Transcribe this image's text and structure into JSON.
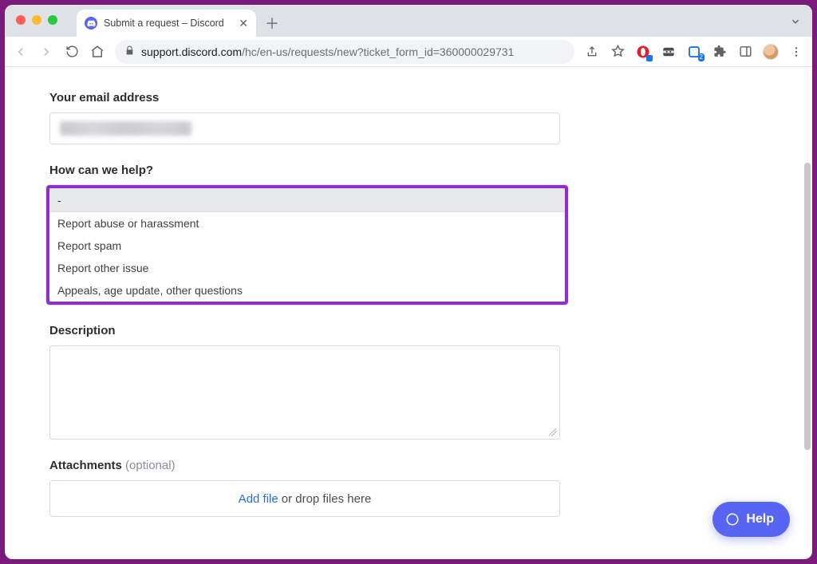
{
  "browser": {
    "tab_title": "Submit a request – Discord",
    "url_host": "support.discord.com",
    "url_path": "/hc/en-us/requests/new?ticket_form_id=360000029731",
    "extension_badge": "2"
  },
  "form": {
    "email_label": "Your email address",
    "help_label": "How can we help?",
    "dropdown": {
      "selected": "-",
      "options": [
        "Report abuse or harassment",
        "Report spam",
        "Report other issue",
        "Appeals, age update, other questions"
      ]
    },
    "description_label": "Description",
    "attachments_label": "Attachments",
    "attachments_optional": "(optional)",
    "add_file": "Add file",
    "drop_text": " or drop files here"
  },
  "help_widget": {
    "label": "Help"
  },
  "colors": {
    "highlight": "#8e2ecb",
    "discord_blurple": "#5865F2",
    "link_blue": "#1f6feb"
  }
}
